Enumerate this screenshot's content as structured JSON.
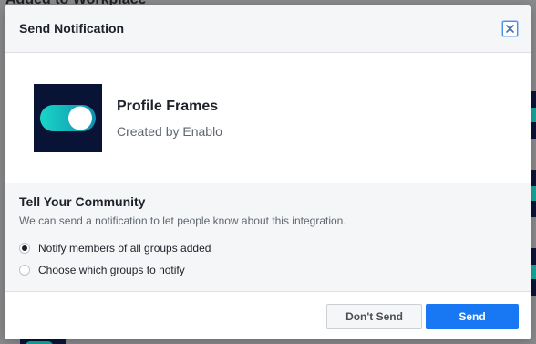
{
  "background": {
    "page_title": "Added to Workplace"
  },
  "dialog": {
    "title": "Send Notification",
    "close_icon": "close-icon"
  },
  "app": {
    "name": "Profile Frames",
    "creator": "Created by Enablo",
    "logo_icon": "toggle-switch-icon",
    "logo_colors": {
      "background": "#081335",
      "track": "#14b8b0",
      "knob": "#ffffff"
    }
  },
  "community": {
    "title": "Tell Your Community",
    "description": "We can send a notification to let people know about this integration.",
    "options": [
      {
        "label": "Notify members of all groups added",
        "checked": true
      },
      {
        "label": "Choose which groups to notify",
        "checked": false
      }
    ]
  },
  "footer": {
    "dont_send_label": "Don't Send",
    "send_label": "Send"
  },
  "colors": {
    "primary": "#1877f2",
    "overlay": "#8a8b8d"
  }
}
